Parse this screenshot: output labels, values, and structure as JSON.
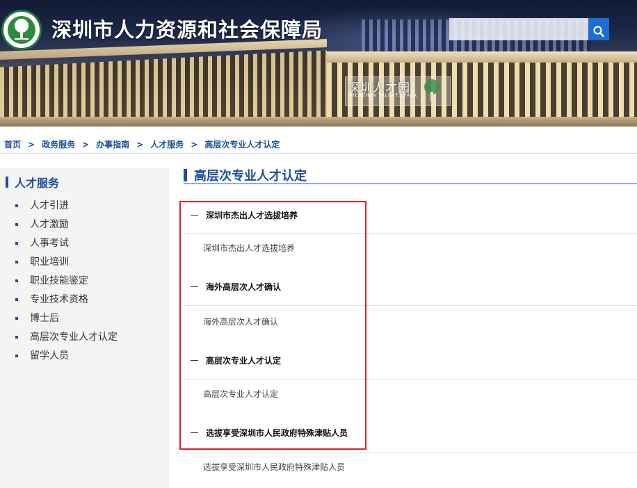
{
  "header": {
    "site_title": "深圳市人力资源和社会保障局",
    "search_placeholder": "",
    "search_icon": "search-icon",
    "banner_sign_text": "深圳人才园",
    "banner_sign_subtext": "SHENZHEN TALENTS PARK"
  },
  "breadcrumb": {
    "items": [
      "首页",
      "政务服务",
      "办事指南",
      "人才服务",
      "高层次专业人才认定"
    ],
    "separator": ">"
  },
  "sidebar": {
    "title": "人才服务",
    "items": [
      "人才引进",
      "人才激励",
      "人事考试",
      "职业培训",
      "职业技能鉴定",
      "专业技术资格",
      "博士后",
      "高层次专业人才认定",
      "留学人员"
    ]
  },
  "main": {
    "title": "高层次专业人才认定",
    "sections": [
      {
        "heading": "深圳市杰出人才选拔培养",
        "items": [
          "深圳市杰出人才选拔培养"
        ]
      },
      {
        "heading": "海外高层次人才确认",
        "items": [
          "海外高层次人才确认"
        ]
      },
      {
        "heading": "高层次专业人才认定",
        "items": [
          "高层次专业人才认定"
        ]
      },
      {
        "heading": "选拔享受深圳市人民政府特殊津贴人员",
        "items": [
          "选拔享受深圳市人民政府特殊津贴人员"
        ]
      }
    ]
  },
  "colors": {
    "accent": "#1a4f9c",
    "search_button": "#1a6fd0",
    "highlight_border": "#e02020",
    "sidebar_bg": "#f4f4f4"
  }
}
